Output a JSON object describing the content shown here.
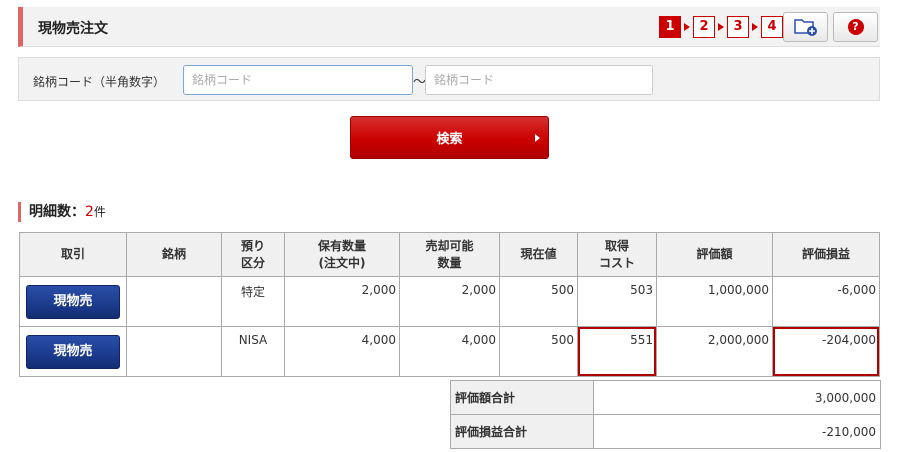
{
  "header": {
    "title": "現物売注文",
    "steps": [
      "1",
      "2",
      "3",
      "4"
    ],
    "folder_icon": "folder-add-icon",
    "help_icon": "help-icon",
    "help_symbol": "?"
  },
  "search": {
    "label": "銘柄コード（半角数字）",
    "from_placeholder": "銘柄コード",
    "to_placeholder": "銘柄コード",
    "separator": "～",
    "button_label": "検索"
  },
  "summary": {
    "label": "明細数：",
    "count": "2",
    "unit": "件"
  },
  "table": {
    "headers": {
      "trade": "取引",
      "stock": "銘柄",
      "deposit_line1": "預り",
      "deposit_line2": "区分",
      "holding_line1": "保有数量",
      "holding_line2": "(注文中)",
      "sellable_line1": "売却可能",
      "sellable_line2": "数量",
      "price": "現在値",
      "cost_line1": "取得",
      "cost_line2": "コスト",
      "valuation": "評価額",
      "pl": "評価損益"
    },
    "rows": [
      {
        "button": "現物売",
        "stock": "",
        "deposit": "特定",
        "holding": "2,000",
        "sellable": "2,000",
        "price": "500",
        "cost": "503",
        "valuation": "1,000,000",
        "pl": "-6,000"
      },
      {
        "button": "現物売",
        "stock": "",
        "deposit": "NISA",
        "holding": "4,000",
        "sellable": "4,000",
        "price": "500",
        "cost": "551",
        "valuation": "2,000,000",
        "pl": "-204,000"
      }
    ]
  },
  "totals": {
    "valuation_label": "評価額合計",
    "valuation_value": "3,000,000",
    "pl_label": "評価損益合計",
    "pl_value": "-210,000"
  },
  "colors": {
    "accent_red": "#cc0000",
    "button_blue": "#1b3a8c",
    "negative_blue": "#2a62a8"
  }
}
